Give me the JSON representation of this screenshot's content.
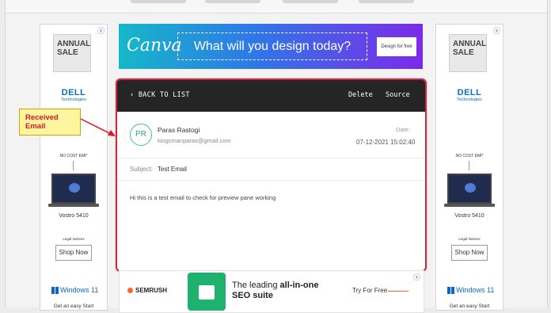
{
  "left_ad": {
    "close": "ⓧ",
    "sale_text": "ANNUAL SALE",
    "brand": "DELL",
    "brand_sub": "Technologies",
    "offer": "NO COST EMI*",
    "model": "Vostro 5410",
    "legal": "Legal Notices",
    "cta": "Shop Now",
    "os": "Windows 11",
    "footer": "Get an easy Start"
  },
  "right_ad": {
    "close": "ⓧ",
    "sale_text": "ANNUAL SALE",
    "brand": "DELL",
    "brand_sub": "Technologies",
    "offer": "NO COST EMI*",
    "model": "Vostro 5410",
    "legal": "Legal Notices",
    "cta": "Shop Now",
    "os": "Windows 11",
    "footer": "Get an easy Start"
  },
  "top_banner": {
    "brand": "Canva",
    "headline": "What will you design today?",
    "cta": "Design for free"
  },
  "email": {
    "back_label": "‹   BACK TO LIST",
    "delete_label": "Delete",
    "source_label": "Source",
    "avatar_initials": "PR",
    "sender_name": "Paras Rastogi",
    "sender_email": "kingsmanparas@gmail.com",
    "date_label": "Date:",
    "date_value": "07-12-2021 15:02:40",
    "subject_label": "Subject:",
    "subject_value": "Test Email",
    "body": "Hi this is a test email to check for preview pane working"
  },
  "callout": {
    "line1": "Received",
    "line2": "Email"
  },
  "bottom_banner": {
    "close": "ⓧ",
    "brand": "SEMRUSH",
    "tagline_plain": "The leading ",
    "tagline_bold": "all-in-one",
    "tagline_line2": "SEO suite",
    "cta": "Try For Free"
  },
  "colors": {
    "highlight_border": "#d8233b",
    "header_bg": "#252525",
    "avatar": "#2fa56f",
    "callout_bg": "#fff59e",
    "callout_text": "#d9181f"
  }
}
